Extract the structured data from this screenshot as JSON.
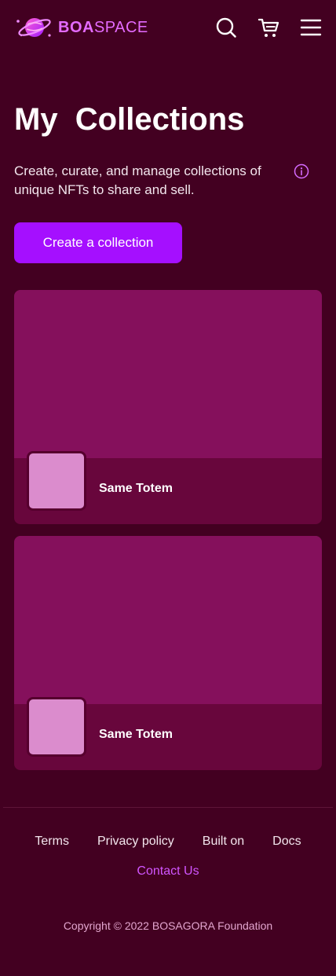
{
  "header": {
    "logo_bold": "BOA",
    "logo_light": "SPACE",
    "icons": [
      "search-icon",
      "cart-icon",
      "menu-icon"
    ]
  },
  "main": {
    "title": "My  Collections",
    "subtitle": "Create, curate, and manage collections of unique NFTs to share and sell.",
    "create_label": "Create a collection",
    "collections": [
      {
        "name": "Same Totem"
      },
      {
        "name": "Same Totem"
      }
    ]
  },
  "footer": {
    "links": [
      "Terms",
      "Privacy policy",
      "Built on",
      "Docs"
    ],
    "contact": "Contact Us",
    "copyright": "Copyright © 2022 BOSAGORA Foundation"
  },
  "colors": {
    "background": "#430021",
    "accent": "#a50fff",
    "logo": "#e46bff",
    "card": "#68063c",
    "card_banner": "#85105c",
    "thumbnail": "#db8ccd",
    "contact": "#d155ff"
  }
}
